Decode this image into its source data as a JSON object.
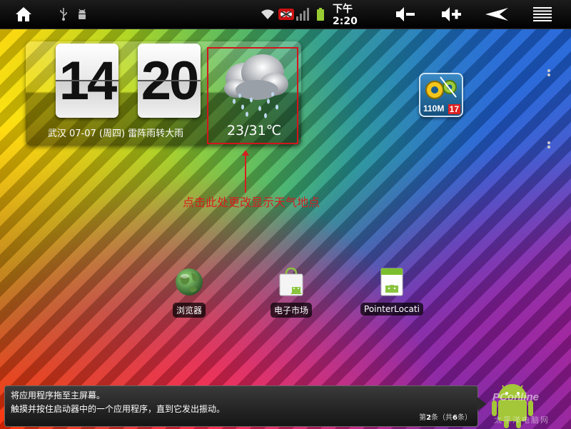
{
  "status_bar": {
    "clock": "下午 2:20",
    "icons": [
      "home-icon",
      "usb-icon",
      "debug-icon",
      "wifi-icon",
      "alert-icon",
      "signal-icon",
      "battery-icon",
      "volume-down-icon",
      "volume-up-icon",
      "back-icon",
      "menu-icon"
    ]
  },
  "widget": {
    "hours": "14",
    "minutes": "20",
    "date_line": "武汉   07-07 (周四)   雷阵雨转大雨",
    "temperature": "23/31℃",
    "weather_icon": "rain-cloud-icon"
  },
  "annotation": {
    "text": "点击此处更改显示天气地点",
    "color": "#d81e1e"
  },
  "shortcut": {
    "label": "110M",
    "count": "17"
  },
  "apps": [
    {
      "label": "浏览器",
      "icon": "globe-icon"
    },
    {
      "label": "电子市场",
      "icon": "market-bag-icon"
    },
    {
      "label": "PointerLocati",
      "icon": "android-app-icon"
    }
  ],
  "hint": {
    "line1": "将应用程序拖至主屏幕。",
    "line2": "触摸并按住启动器中的一个应用程序，直到它发出振动。",
    "page_prefix": "第",
    "page_current": "2",
    "page_mid": "条（共",
    "page_total": "6",
    "page_suffix": "条）"
  },
  "watermark": {
    "brand": "PConline",
    "sub": "太平洋电脑网"
  }
}
